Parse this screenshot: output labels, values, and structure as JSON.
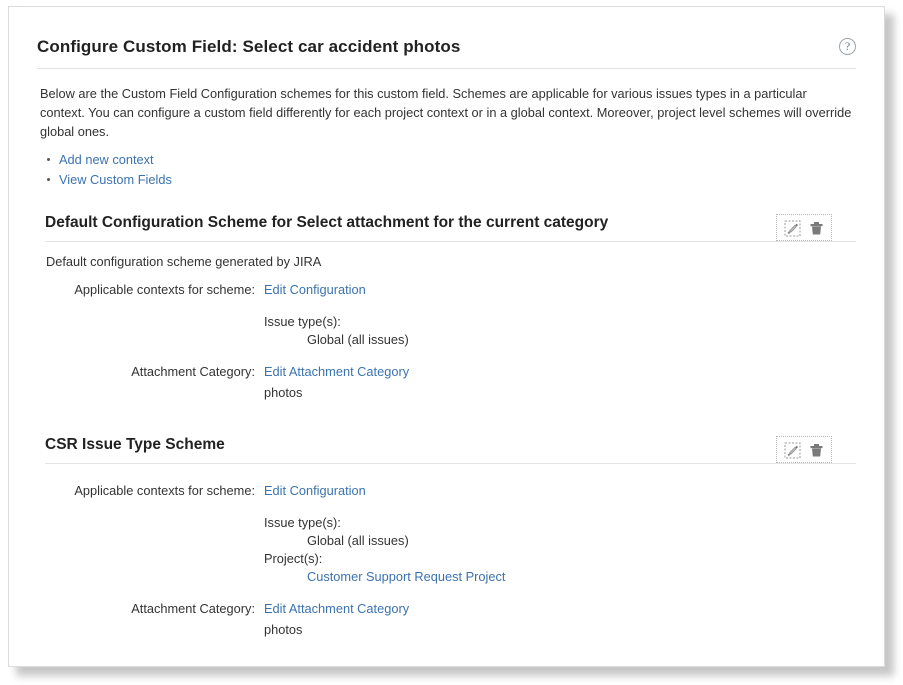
{
  "page": {
    "title": "Configure Custom Field: Select car accident photos",
    "help_icon_label": "?",
    "description": "Below are the Custom Field Configuration schemes for this custom field. Schemes are applicable for various issues types in a particular context. You can configure a custom field differently for each project context or in a global context. Moreover, project level schemes will override global ones."
  },
  "actions": [
    {
      "label": "Add new context"
    },
    {
      "label": "View Custom Fields"
    }
  ],
  "operations": {
    "edit_icon": "edit-pencil-icon",
    "delete_icon": "trash-icon"
  },
  "labels": {
    "applicable_contexts": "Applicable contexts for scheme:",
    "attachment_category": "Attachment Category:",
    "issue_types": "Issue type(s):",
    "projects": "Project(s):"
  },
  "colors": {
    "link": "#3b73af",
    "text": "#333333",
    "heading": "#222222",
    "rule": "#e4e4e4"
  },
  "schemes": [
    {
      "heading": "Default Configuration Scheme for Select attachment for the current category",
      "description": "Default configuration scheme generated by JIRA",
      "edit_configuration_link": "Edit Configuration",
      "issue_types_value": "Global (all issues)",
      "edit_attachment_category_link": "Edit Attachment Category",
      "attachment_category_value": "photos"
    },
    {
      "heading": "CSR Issue Type Scheme",
      "edit_configuration_link": "Edit Configuration",
      "issue_types_value": "Global (all issues)",
      "projects_value": "Customer Support Request Project",
      "edit_attachment_category_link": "Edit Attachment Category",
      "attachment_category_value": "photos"
    }
  ]
}
